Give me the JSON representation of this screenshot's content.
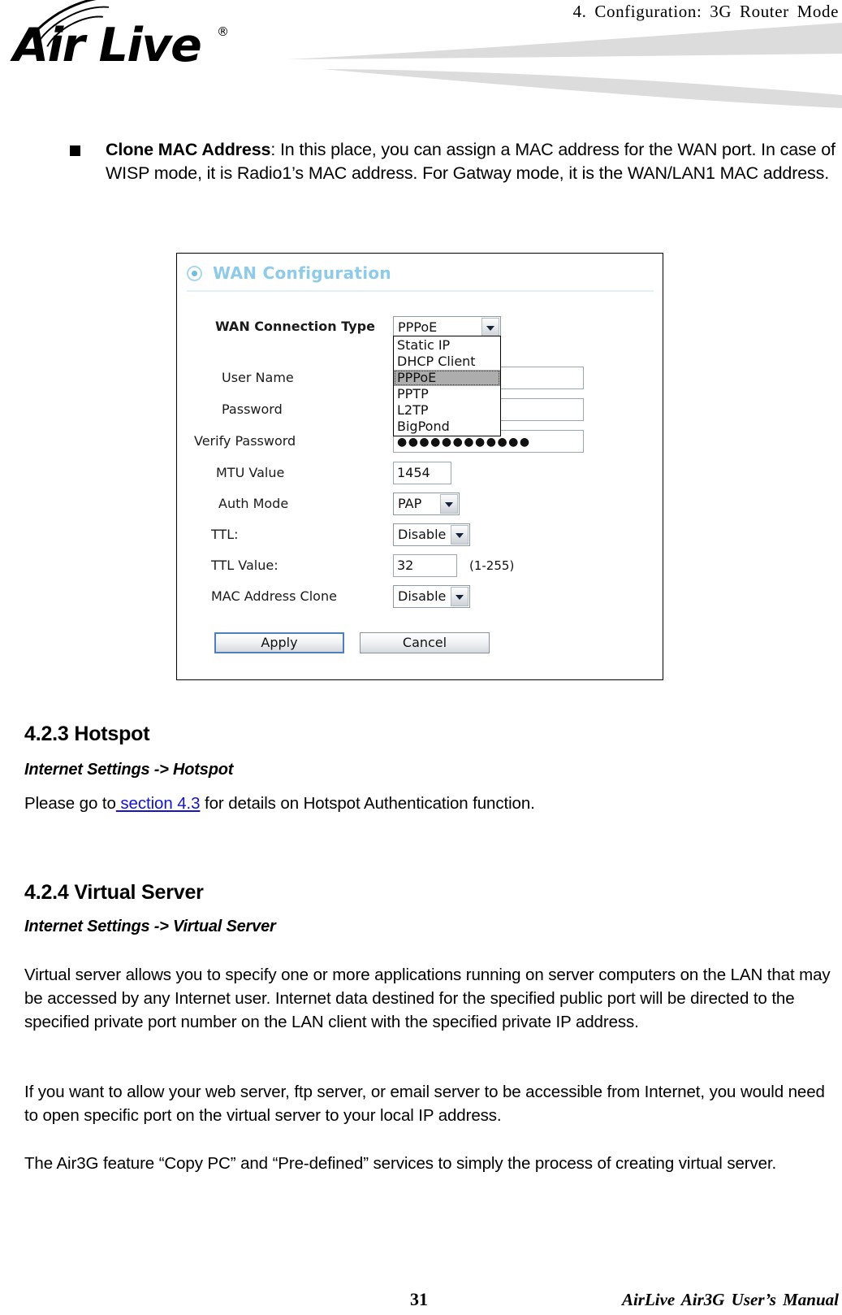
{
  "header": {
    "running_head": "4. Configuration: 3G Router Mode",
    "logo_wordmark": "Air Live",
    "logo_registered": "®"
  },
  "bullet": {
    "term": "Clone MAC Address",
    "colon": ":",
    "body": "   In this place, you can assign a MAC address for the WAN port.   In case of WISP mode, it is Radio1’s MAC address.   For Gatway mode, it is the WAN/LAN1 MAC address."
  },
  "wan_screenshot": {
    "panel_title": "WAN Configuration",
    "fields": {
      "wan_connection_type_label": "WAN Connection Type",
      "wan_connection_type_value": "PPPoE",
      "user_name_label": "User Name",
      "user_name_value": "",
      "password_label": "Password",
      "password_value": "",
      "verify_password_label": "Verify Password",
      "verify_password_value": "●●●●●●●●●●●●",
      "mtu_value_label": "MTU Value",
      "mtu_value_value": "1454",
      "auth_mode_label": "Auth Mode",
      "auth_mode_value": "PAP",
      "ttl_label": "TTL:",
      "ttl_value": "Disable",
      "ttl_value_label": "TTL Value:",
      "ttl_value_value": "32",
      "ttl_value_range": "(1-255)",
      "mac_address_clone_label": "MAC Address Clone",
      "mac_address_clone_value": "Disable"
    },
    "wan_type_options": [
      "Static IP",
      "DHCP Client",
      "PPPoE",
      "PPTP",
      "L2TP",
      "BigPond"
    ],
    "wan_type_selected": "PPPoE",
    "buttons": {
      "apply": "Apply",
      "cancel": "Cancel"
    },
    "colors": {
      "panel_title": "#8ecbea",
      "highlight": "#adadad",
      "apply_focus_border": "#4f7fbf"
    }
  },
  "sections": {
    "hotspot": {
      "heading": "4.2.3 Hotspot",
      "subheading": "Internet Settings -> Hotspot",
      "paragraph_prefix": "Please go to",
      "link_text": " section 4.3",
      "paragraph_suffix": " for details on Hotspot Authentication function."
    },
    "virtual_server": {
      "heading": "4.2.4 Virtual Server",
      "subheading": "Internet Settings -> Virtual Server",
      "paragraph1": "Virtual server allows you to specify one or more applications running on server computers on the LAN that may be accessed by any Internet user. Internet data destined for the specified public port will be directed to the specified private port number on the LAN client with the specified private IP address.",
      "paragraph2": "If you want to allow your web server, ftp server, or email server to be accessible from Internet, you would need to open specific port on the virtual server to your local IP address.",
      "paragraph3": "The Air3G feature “Copy PC” and “Pre-defined” services to simply the process of creating virtual server."
    }
  },
  "footer": {
    "page_number": "31",
    "manual_title": "AirLive Air3G User’s Manual"
  }
}
